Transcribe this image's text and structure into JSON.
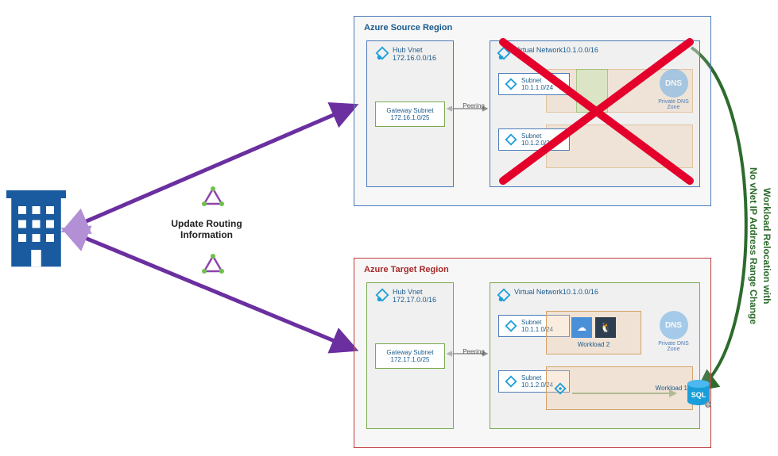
{
  "source_region": {
    "title": "Azure Source Region",
    "hub": {
      "name": "Hub Vnet",
      "cidr": "172.16.0.0/16",
      "gateway": {
        "name": "Gateway Subnet",
        "cidr": "172.16.1.0/25"
      }
    },
    "vnet": {
      "name": "Virtual Network",
      "cidr": "10.1.0.0/16",
      "subnets": [
        {
          "name": "Subnet",
          "cidr": "10.1.1.0/24"
        },
        {
          "name": "Subnet",
          "cidr": "10.1.2.0/24"
        }
      ],
      "dns": "Private DNS Zone",
      "dns_badge": "DNS"
    },
    "peering": "Peering"
  },
  "target_region": {
    "title": "Azure Target Region",
    "hub": {
      "name": "Hub Vnet",
      "cidr": "172.17.0.0/16",
      "gateway": {
        "name": "Gateway Subnet",
        "cidr": "172.17.1.0/25"
      }
    },
    "vnet": {
      "name": "Virtual Network",
      "cidr": "10.1.0.0/16",
      "subnets": [
        {
          "name": "Subnet",
          "cidr": "10.1.1.0/24"
        },
        {
          "name": "Subnet",
          "cidr": "10.1.2.0/24"
        }
      ],
      "dns": "Private DNS Zone",
      "dns_badge": "DNS",
      "workloads": [
        {
          "label": "Workload 2"
        },
        {
          "label": "Workload 1"
        }
      ]
    },
    "peering": "Peering",
    "sql_badge": "SQL"
  },
  "routing_label": "Update Routing Information",
  "side_label_line1": "Workload Relocation with",
  "side_label_line2": "No vNet IP Address Range Change",
  "colors": {
    "source_border": "#4a7bb8",
    "target_border": "#c23b3b",
    "hub_border_src": "#4a7bb8",
    "hub_border_tgt": "#7aa84e"
  }
}
